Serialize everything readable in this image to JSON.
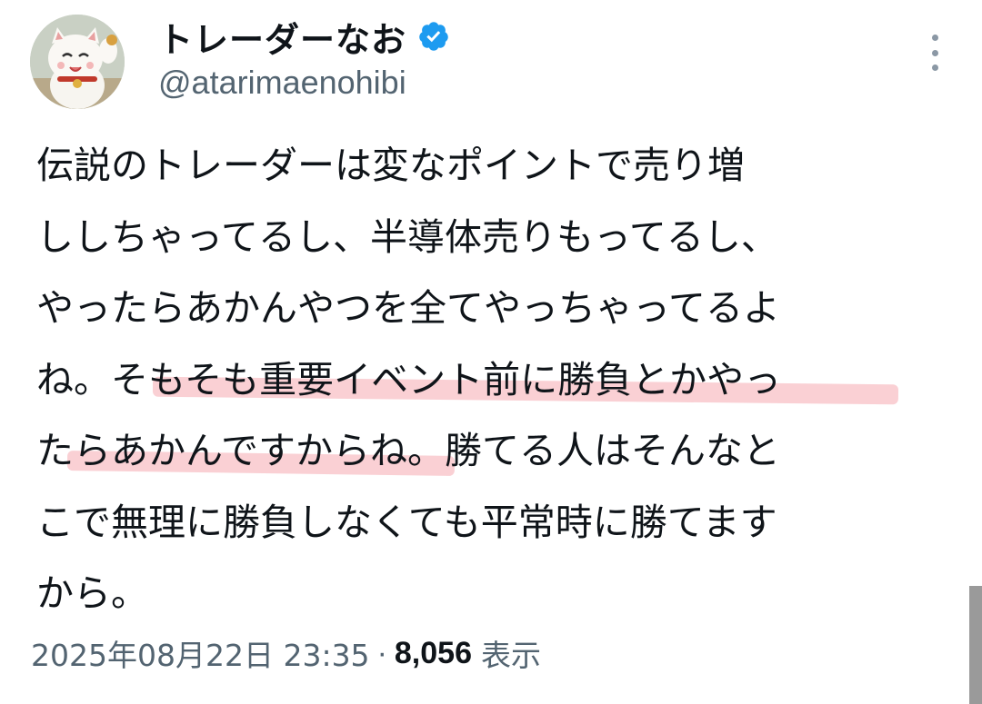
{
  "author": {
    "display_name": "トレーダーなお",
    "handle": "@atarimaenohibi",
    "verified": true,
    "avatar_icon": "maneki-neko-avatar-icon"
  },
  "tweet": {
    "lines": [
      "伝説のトレーダーは変なポイントで売り増",
      "ししちゃってるし、半導体売りもってるし、",
      "やったらあかんやつを全てやっちゃってるよ",
      "ね。そもそも重要イベント前に勝負とかやっ",
      "たらあかんですからね。勝てる人はそんなと",
      "こで無理に勝負しなくても平常時に勝てます",
      "から。"
    ],
    "highlighted_phrases": [
      "そもそも重要イベント前に勝負とかや",
      "らあかんですからね"
    ]
  },
  "meta": {
    "date": "2025年08月22日 23:35",
    "separator": "·",
    "views_count": "8,056",
    "views_label": "表示"
  },
  "colors": {
    "text": "#0f1419",
    "secondary": "#536471",
    "verified_blue": "#1d9bf0",
    "highlight": "#f596a0"
  }
}
